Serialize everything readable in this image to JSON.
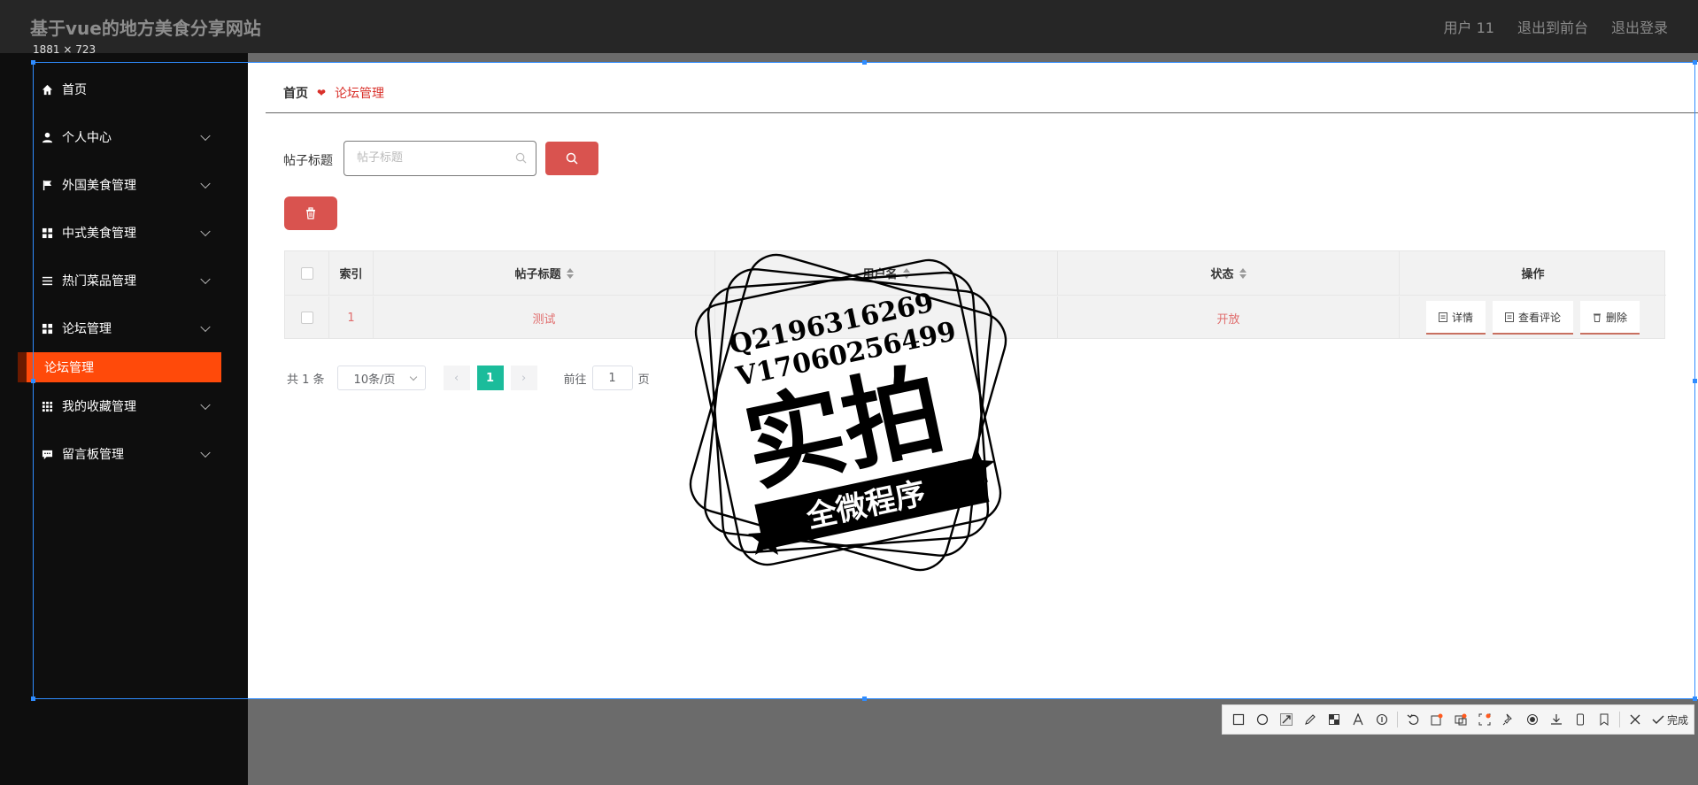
{
  "header": {
    "site_title": "基于vue的地方美食分享网站",
    "user_label": "用户 11",
    "exit_frontend": "退出到前台",
    "logout": "退出登录"
  },
  "capture_size": "1881 × 723",
  "sidebar": {
    "items": [
      {
        "label": "首页",
        "icon": "home-icon"
      },
      {
        "label": "个人中心",
        "icon": "user-icon"
      },
      {
        "label": "外国美食管理",
        "icon": "flag-icon"
      },
      {
        "label": "中式美食管理",
        "icon": "grid-icon"
      },
      {
        "label": "热门菜品管理",
        "icon": "list-icon"
      },
      {
        "label": "论坛管理",
        "icon": "grid-icon"
      },
      {
        "label": "我的收藏管理",
        "icon": "apps-icon"
      },
      {
        "label": "留言板管理",
        "icon": "message-icon"
      }
    ],
    "active_sub": "论坛管理"
  },
  "breadcrumb": {
    "home": "首页",
    "current": "论坛管理"
  },
  "search": {
    "label": "帖子标题",
    "placeholder": "帖子标题"
  },
  "table": {
    "headers": [
      "索引",
      "帖子标题",
      "用户名",
      "状态",
      "操作"
    ],
    "rows": [
      {
        "index": "1",
        "title": "测试",
        "username": "",
        "status": "开放"
      }
    ],
    "actions": [
      "详情",
      "查看评论",
      "删除"
    ]
  },
  "pagination": {
    "total": "共 1 条",
    "page_size": "10条/页",
    "current_page": "1",
    "goto_label": "前往",
    "goto_value": "1",
    "page_suffix": "页"
  },
  "watermark": {
    "line1": "Q2196316269",
    "line2": "V17060256499",
    "main": "实拍",
    "banner": "全微程序"
  },
  "toolbar": {
    "done_label": "完成"
  },
  "colors": {
    "accent_red": "#d9534f",
    "active_orange": "#ff4a0a",
    "pager_green": "#1bbc9b"
  }
}
